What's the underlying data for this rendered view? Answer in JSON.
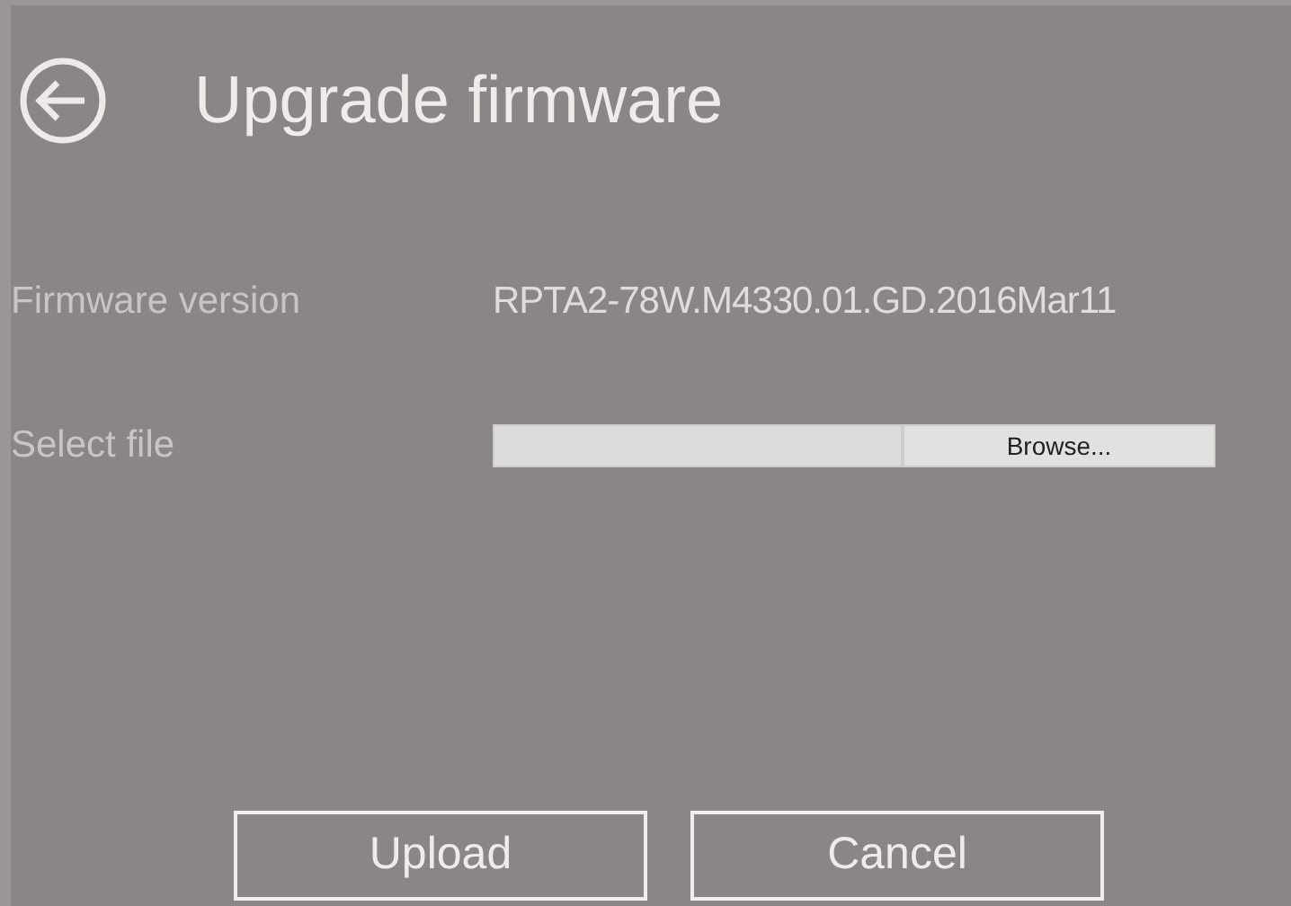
{
  "header": {
    "title": "Upgrade firmware"
  },
  "fields": [
    {
      "kind": "text",
      "label": "Firmware version",
      "value": "RPTA2-78W.M4330.01.GD.2016Mar11"
    },
    {
      "kind": "file",
      "label": "Select file",
      "button": "Browse..."
    }
  ],
  "buttons": [
    "Upload",
    "Cancel"
  ]
}
